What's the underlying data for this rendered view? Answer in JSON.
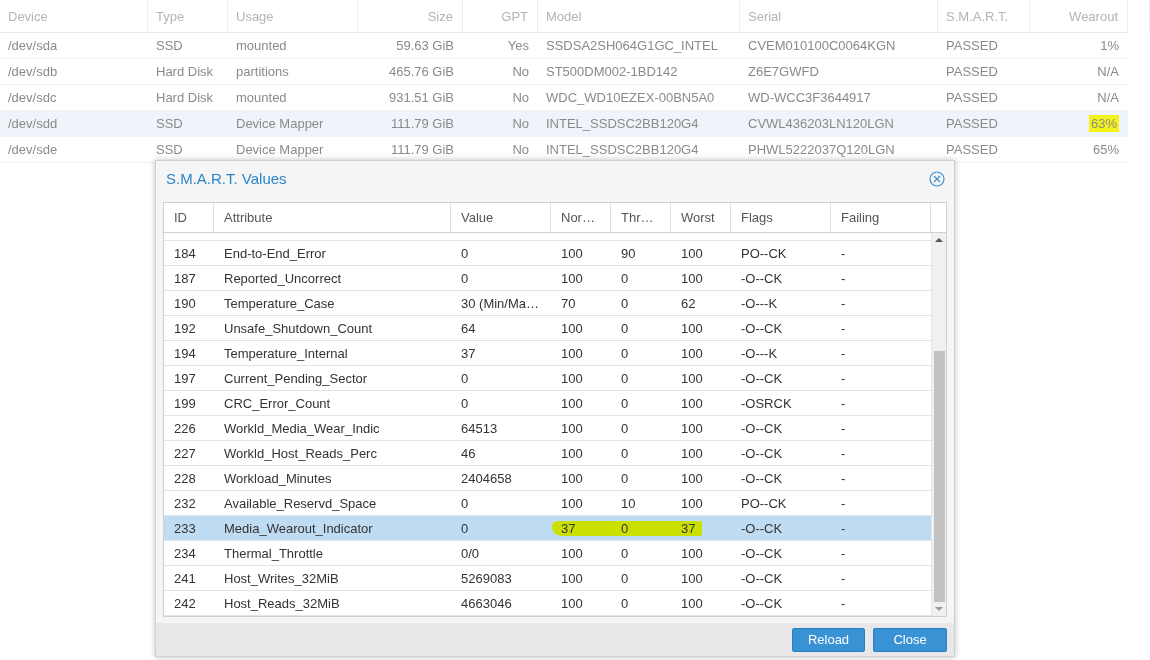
{
  "disks": {
    "columns": [
      "Device",
      "Type",
      "Usage",
      "Size",
      "GPT",
      "Model",
      "Serial",
      "S.M.A.R.T.",
      "Wearout"
    ],
    "rows": [
      {
        "selected": false,
        "cells": [
          "/dev/sda",
          "SSD",
          "mounted",
          "59.63 GiB",
          "Yes",
          "SSDSA2SH064G1GC_INTEL",
          "CVEM010100C0064KGN",
          "PASSED",
          "1%"
        ],
        "wearout_highlighted": false
      },
      {
        "selected": false,
        "cells": [
          "/dev/sdb",
          "Hard Disk",
          "partitions",
          "465.76 GiB",
          "No",
          "ST500DM002-1BD142",
          "Z6E7GWFD",
          "PASSED",
          "N/A"
        ],
        "wearout_highlighted": false
      },
      {
        "selected": false,
        "cells": [
          "/dev/sdc",
          "Hard Disk",
          "mounted",
          "931.51 GiB",
          "No",
          "WDC_WD10EZEX-00BN5A0",
          "WD-WCC3F3644917",
          "PASSED",
          "N/A"
        ],
        "wearout_highlighted": false
      },
      {
        "selected": true,
        "cells": [
          "/dev/sdd",
          "SSD",
          "Device Mapper",
          "111.79 GiB",
          "No",
          "INTEL_SSDSC2BB120G4",
          "CVWL436203LN120LGN",
          "PASSED",
          "63%"
        ],
        "wearout_highlighted": true
      },
      {
        "selected": false,
        "cells": [
          "/dev/sde",
          "SSD",
          "Device Mapper",
          "111.79 GiB",
          "No",
          "INTEL_SSDSC2BB120G4",
          "PHWL5222037Q120LGN",
          "PASSED",
          "65%"
        ],
        "wearout_highlighted": false
      }
    ]
  },
  "dialog": {
    "title": "S.M.A.R.T. Values",
    "columns": [
      "ID",
      "Attribute",
      "Value",
      "Nor…",
      "Thr…",
      "Worst",
      "Flags",
      "Failing"
    ],
    "rows": [
      {
        "selected": false,
        "highlighted": false,
        "cells": [
          "184",
          "End-to-End_Error",
          "0",
          "100",
          "90",
          "100",
          "PO--CK",
          "-"
        ]
      },
      {
        "selected": false,
        "highlighted": false,
        "cells": [
          "187",
          "Reported_Uncorrect",
          "0",
          "100",
          "0",
          "100",
          "-O--CK",
          "-"
        ]
      },
      {
        "selected": false,
        "highlighted": false,
        "cells": [
          "190",
          "Temperature_Case",
          "30 (Min/Ma…",
          "70",
          "0",
          "62",
          "-O---K",
          "-"
        ]
      },
      {
        "selected": false,
        "highlighted": false,
        "cells": [
          "192",
          "Unsafe_Shutdown_Count",
          "64",
          "100",
          "0",
          "100",
          "-O--CK",
          "-"
        ]
      },
      {
        "selected": false,
        "highlighted": false,
        "cells": [
          "194",
          "Temperature_Internal",
          "37",
          "100",
          "0",
          "100",
          "-O---K",
          "-"
        ]
      },
      {
        "selected": false,
        "highlighted": false,
        "cells": [
          "197",
          "Current_Pending_Sector",
          "0",
          "100",
          "0",
          "100",
          "-O--CK",
          "-"
        ]
      },
      {
        "selected": false,
        "highlighted": false,
        "cells": [
          "199",
          "CRC_Error_Count",
          "0",
          "100",
          "0",
          "100",
          "-OSRCK",
          "-"
        ]
      },
      {
        "selected": false,
        "highlighted": false,
        "cells": [
          "226",
          "Workld_Media_Wear_Indic",
          "64513",
          "100",
          "0",
          "100",
          "-O--CK",
          "-"
        ]
      },
      {
        "selected": false,
        "highlighted": false,
        "cells": [
          "227",
          "Workld_Host_Reads_Perc",
          "46",
          "100",
          "0",
          "100",
          "-O--CK",
          "-"
        ]
      },
      {
        "selected": false,
        "highlighted": false,
        "cells": [
          "228",
          "Workload_Minutes",
          "2404658",
          "100",
          "0",
          "100",
          "-O--CK",
          "-"
        ]
      },
      {
        "selected": false,
        "highlighted": false,
        "cells": [
          "232",
          "Available_Reservd_Space",
          "0",
          "100",
          "10",
          "100",
          "PO--CK",
          "-"
        ]
      },
      {
        "selected": true,
        "highlighted": true,
        "cells": [
          "233",
          "Media_Wearout_Indicator",
          "0",
          "37",
          "0",
          "37",
          "-O--CK",
          "-"
        ]
      },
      {
        "selected": false,
        "highlighted": false,
        "cells": [
          "234",
          "Thermal_Throttle",
          "0/0",
          "100",
          "0",
          "100",
          "-O--CK",
          "-"
        ]
      },
      {
        "selected": false,
        "highlighted": false,
        "cells": [
          "241",
          "Host_Writes_32MiB",
          "5269083",
          "100",
          "0",
          "100",
          "-O--CK",
          "-"
        ]
      },
      {
        "selected": false,
        "highlighted": false,
        "cells": [
          "242",
          "Host_Reads_32MiB",
          "4663046",
          "100",
          "0",
          "100",
          "-O--CK",
          "-"
        ]
      }
    ],
    "buttons": [
      "Reload",
      "Close"
    ]
  }
}
